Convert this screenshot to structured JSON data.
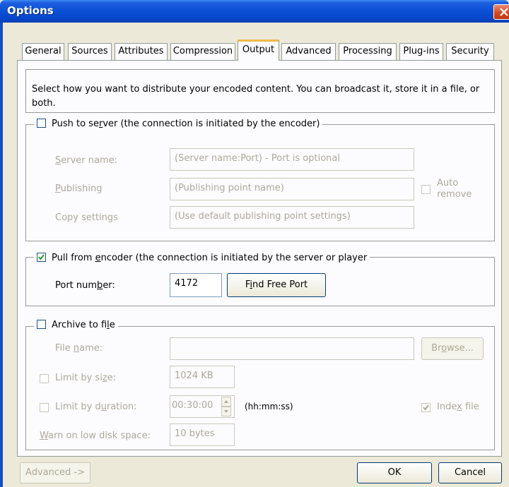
{
  "window": {
    "title": "Options"
  },
  "tabs": [
    {
      "label": "General"
    },
    {
      "label": "Sources"
    },
    {
      "label": "Attributes"
    },
    {
      "label": "Compression"
    },
    {
      "label": "Output",
      "active": true
    },
    {
      "label": "Advanced"
    },
    {
      "label": "Processing"
    },
    {
      "label": "Plug-ins"
    },
    {
      "label": "Security"
    }
  ],
  "info": {
    "text": "Select how you want to distribute your encoded content. You can broadcast it, store it in a file, or both."
  },
  "push": {
    "label_pre": "Push to se",
    "label_u": "r",
    "label_post": "ver (the connection is initiated by the encoder)",
    "checked": false,
    "server_name": {
      "pre": "",
      "u": "S",
      "post": "erver name:",
      "placeholder": "(Server name:Port)  - Port is optional"
    },
    "publishing": {
      "pre": "",
      "u": "P",
      "post": "ublishing",
      "placeholder": "(Publishing point name)"
    },
    "copy_settings": {
      "label": "Copy settings",
      "placeholder": "(Use default publishing point settings)"
    },
    "auto_remove": {
      "line1": "Auto",
      "line2": "remove",
      "checked": false
    }
  },
  "pull": {
    "label_pre": "Pull from ",
    "label_u": "e",
    "label_post": "ncoder (the connection is initiated by the server or player",
    "checked": true,
    "port": {
      "pre": "Port num",
      "u": "b",
      "post": "er:",
      "value": "4172"
    },
    "find_port": {
      "pre": "F",
      "u": "i",
      "post": "nd Free Port"
    }
  },
  "archive": {
    "label_pre": "Archive to fi",
    "label_u": "l",
    "label_post": "e",
    "checked": false,
    "file_name": {
      "pre": "File ",
      "u": "n",
      "post": "ame:",
      "value": ""
    },
    "browse": {
      "pre": "Br",
      "u": "o",
      "post": "wse..."
    },
    "limit_size": {
      "pre": "Limit by si",
      "u": "z",
      "post": "e:",
      "value": "1024 KB",
      "checked": false
    },
    "limit_duration": {
      "pre": "Limit by d",
      "u": "u",
      "post": "ration:",
      "value": "00:30:00",
      "unit": "(hh:mm:ss)",
      "checked": false
    },
    "index_file": {
      "pre": "Inde",
      "u": "x",
      "post": " file",
      "checked": true
    },
    "warn": {
      "pre": "",
      "u": "W",
      "post": "arn on low disk space:",
      "value": "10 bytes"
    }
  },
  "footer": {
    "advanced": "Advanced ->",
    "ok": "OK",
    "cancel": "Cancel"
  }
}
